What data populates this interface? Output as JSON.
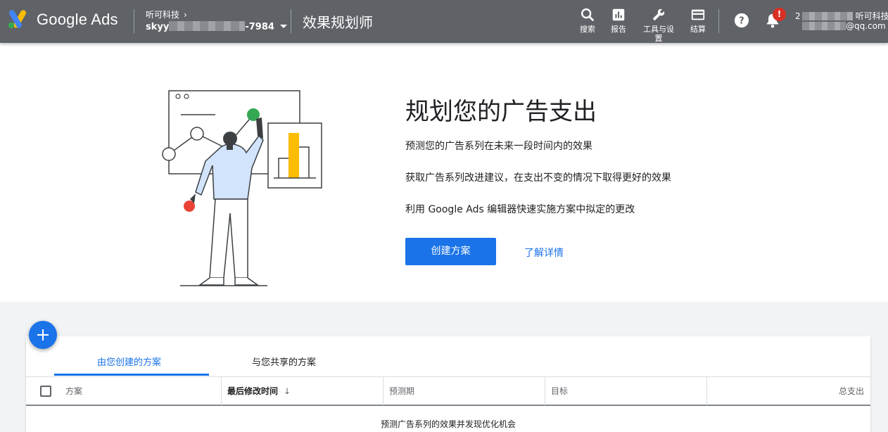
{
  "header": {
    "brand": "Google Ads",
    "account_path": "听可科技",
    "account_id_prefix": "skyy",
    "account_id_suffix": "-7984",
    "page_title": "效果规划师",
    "tools": [
      {
        "label": "搜索",
        "icon": "search-icon"
      },
      {
        "label": "报告",
        "icon": "reports-icon"
      },
      {
        "label": "工具与设置",
        "icon": "wrench-icon"
      },
      {
        "label": "结算",
        "icon": "credit-card-icon"
      }
    ],
    "help_icon": "help-icon",
    "notifications_icon": "bell-icon",
    "notification_badge": "!",
    "user_line1_prefix": "2",
    "user_line1_suffix": "听可科技",
    "user_line2_suffix": "@qq.com"
  },
  "hero": {
    "title": "规划您的广告支出",
    "lines": [
      "预测您的广告系列在未来一段时间内的效果",
      "获取广告系列改进建议，在支出不变的情况下取得更好的效果",
      "利用 Google Ads 编辑器快速实施方案中拟定的更改"
    ],
    "primary_button": "创建方案",
    "learn_more": "了解详情"
  },
  "plans": {
    "tabs": [
      "由您创建的方案",
      "与您共享的方案"
    ],
    "active_tab": 0,
    "columns": [
      "方案",
      "最后修改时间",
      "预测期",
      "目标",
      "总支出"
    ],
    "sorted_column": 1,
    "sort_icon": "arrow-down-icon",
    "empty_message": "预测广告系列的效果并发现优化机会"
  },
  "colors": {
    "header_bg": "#5f6368",
    "accent": "#1a73e8",
    "badge": "#d93025",
    "illustration_green": "#34a853",
    "illustration_yellow": "#fbbc04",
    "illustration_red": "#ea4335"
  }
}
